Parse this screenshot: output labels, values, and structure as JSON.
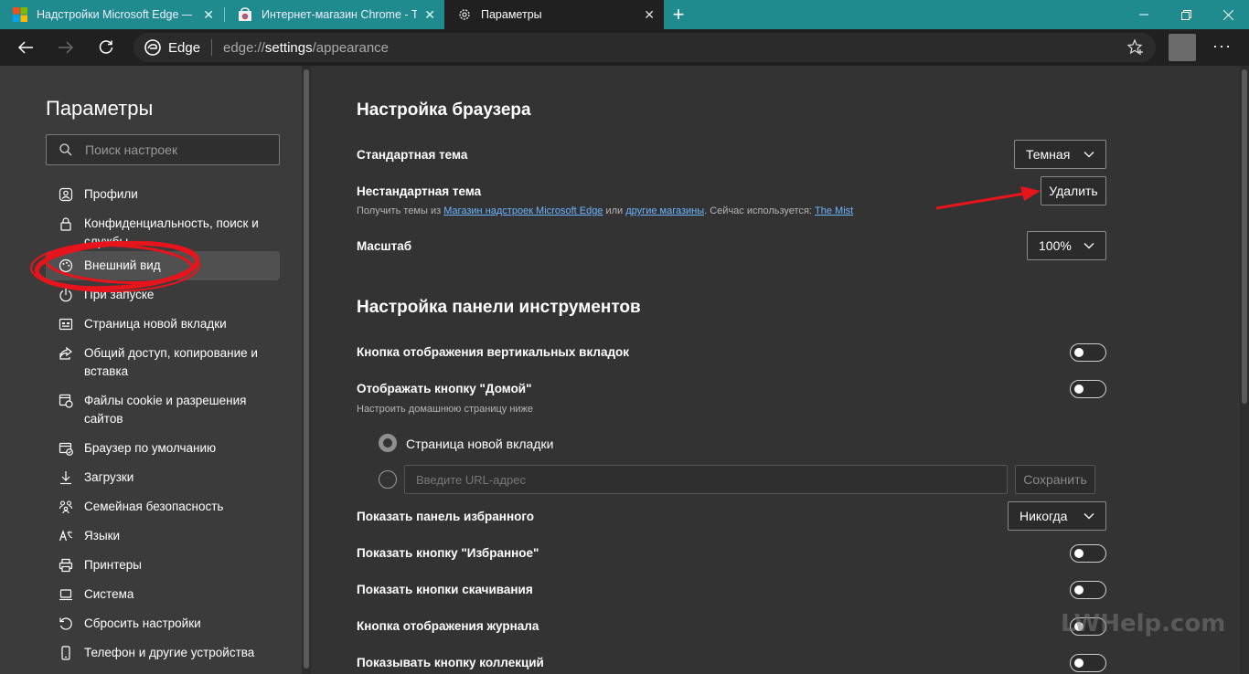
{
  "tabs": [
    {
      "title": "Надстройки Microsoft Edge — Т",
      "active": false
    },
    {
      "title": "Интернет-магазин Chrome - Те",
      "active": false
    },
    {
      "title": "Параметры",
      "active": true
    }
  ],
  "address": {
    "brand": "Edge",
    "url_prefix": "edge://",
    "url_host": "settings",
    "url_path": "/appearance"
  },
  "sidebar": {
    "title": "Параметры",
    "search_placeholder": "Поиск настроек",
    "items": [
      {
        "label": "Профили",
        "icon": "profile-icon"
      },
      {
        "label": "Конфиденциальность, поиск и службы",
        "icon": "lock-icon"
      },
      {
        "label": "Внешний вид",
        "icon": "appearance-icon",
        "active": true
      },
      {
        "label": "При запуске",
        "icon": "power-icon"
      },
      {
        "label": "Страница новой вкладки",
        "icon": "newtab-page-icon"
      },
      {
        "label": "Общий доступ, копирование и вставка",
        "icon": "share-icon"
      },
      {
        "label": "Файлы cookie и разрешения сайтов",
        "icon": "cookie-icon"
      },
      {
        "label": "Браузер по умолчанию",
        "icon": "default-browser-icon"
      },
      {
        "label": "Загрузки",
        "icon": "download-icon"
      },
      {
        "label": "Семейная безопасность",
        "icon": "family-icon"
      },
      {
        "label": "Языки",
        "icon": "languages-icon"
      },
      {
        "label": "Принтеры",
        "icon": "printer-icon"
      },
      {
        "label": "Система",
        "icon": "system-icon"
      },
      {
        "label": "Сбросить настройки",
        "icon": "reset-icon"
      },
      {
        "label": "Телефон и другие устройства",
        "icon": "phone-icon"
      }
    ]
  },
  "main": {
    "section1_title": "Настройка браузера",
    "default_theme_label": "Стандартная тема",
    "default_theme_value": "Темная",
    "custom_theme_label": "Нестандартная тема",
    "custom_theme_button": "Удалить",
    "custom_theme_hint": {
      "part1": "Получить темы из ",
      "link1": "Магазин надстроек Microsoft Edge",
      "part2": " или ",
      "link2": "другие магазины",
      "part3": ". Сейчас используется: ",
      "link3": "The Mist"
    },
    "zoom_label": "Масштаб",
    "zoom_value": "100%",
    "section2_title": "Настройка панели инструментов",
    "vertical_tabs_label": "Кнопка отображения вертикальных вкладок",
    "home_button_label": "Отображать кнопку \"Домой\"",
    "home_button_hint": "Настроить домашнюю страницу ниже",
    "radio_newtab_label": "Страница новой вкладки",
    "url_placeholder": "Введите URL-адрес",
    "save_button": "Сохранить",
    "favorites_bar_label": "Показать панель избранного",
    "favorites_bar_value": "Никогда",
    "favorites_button_label": "Показать кнопку \"Избранное\"",
    "downloads_button_label": "Показать кнопки скачивания",
    "history_button_label": "Кнопка отображения журнала",
    "collections_button_label": "Показывать кнопку коллекций"
  },
  "watermark": "LWHelp.com",
  "colors": {
    "tabbar": "#1f8b8f",
    "accent_link": "#6cb4ff",
    "annotation": "#e8141c"
  }
}
